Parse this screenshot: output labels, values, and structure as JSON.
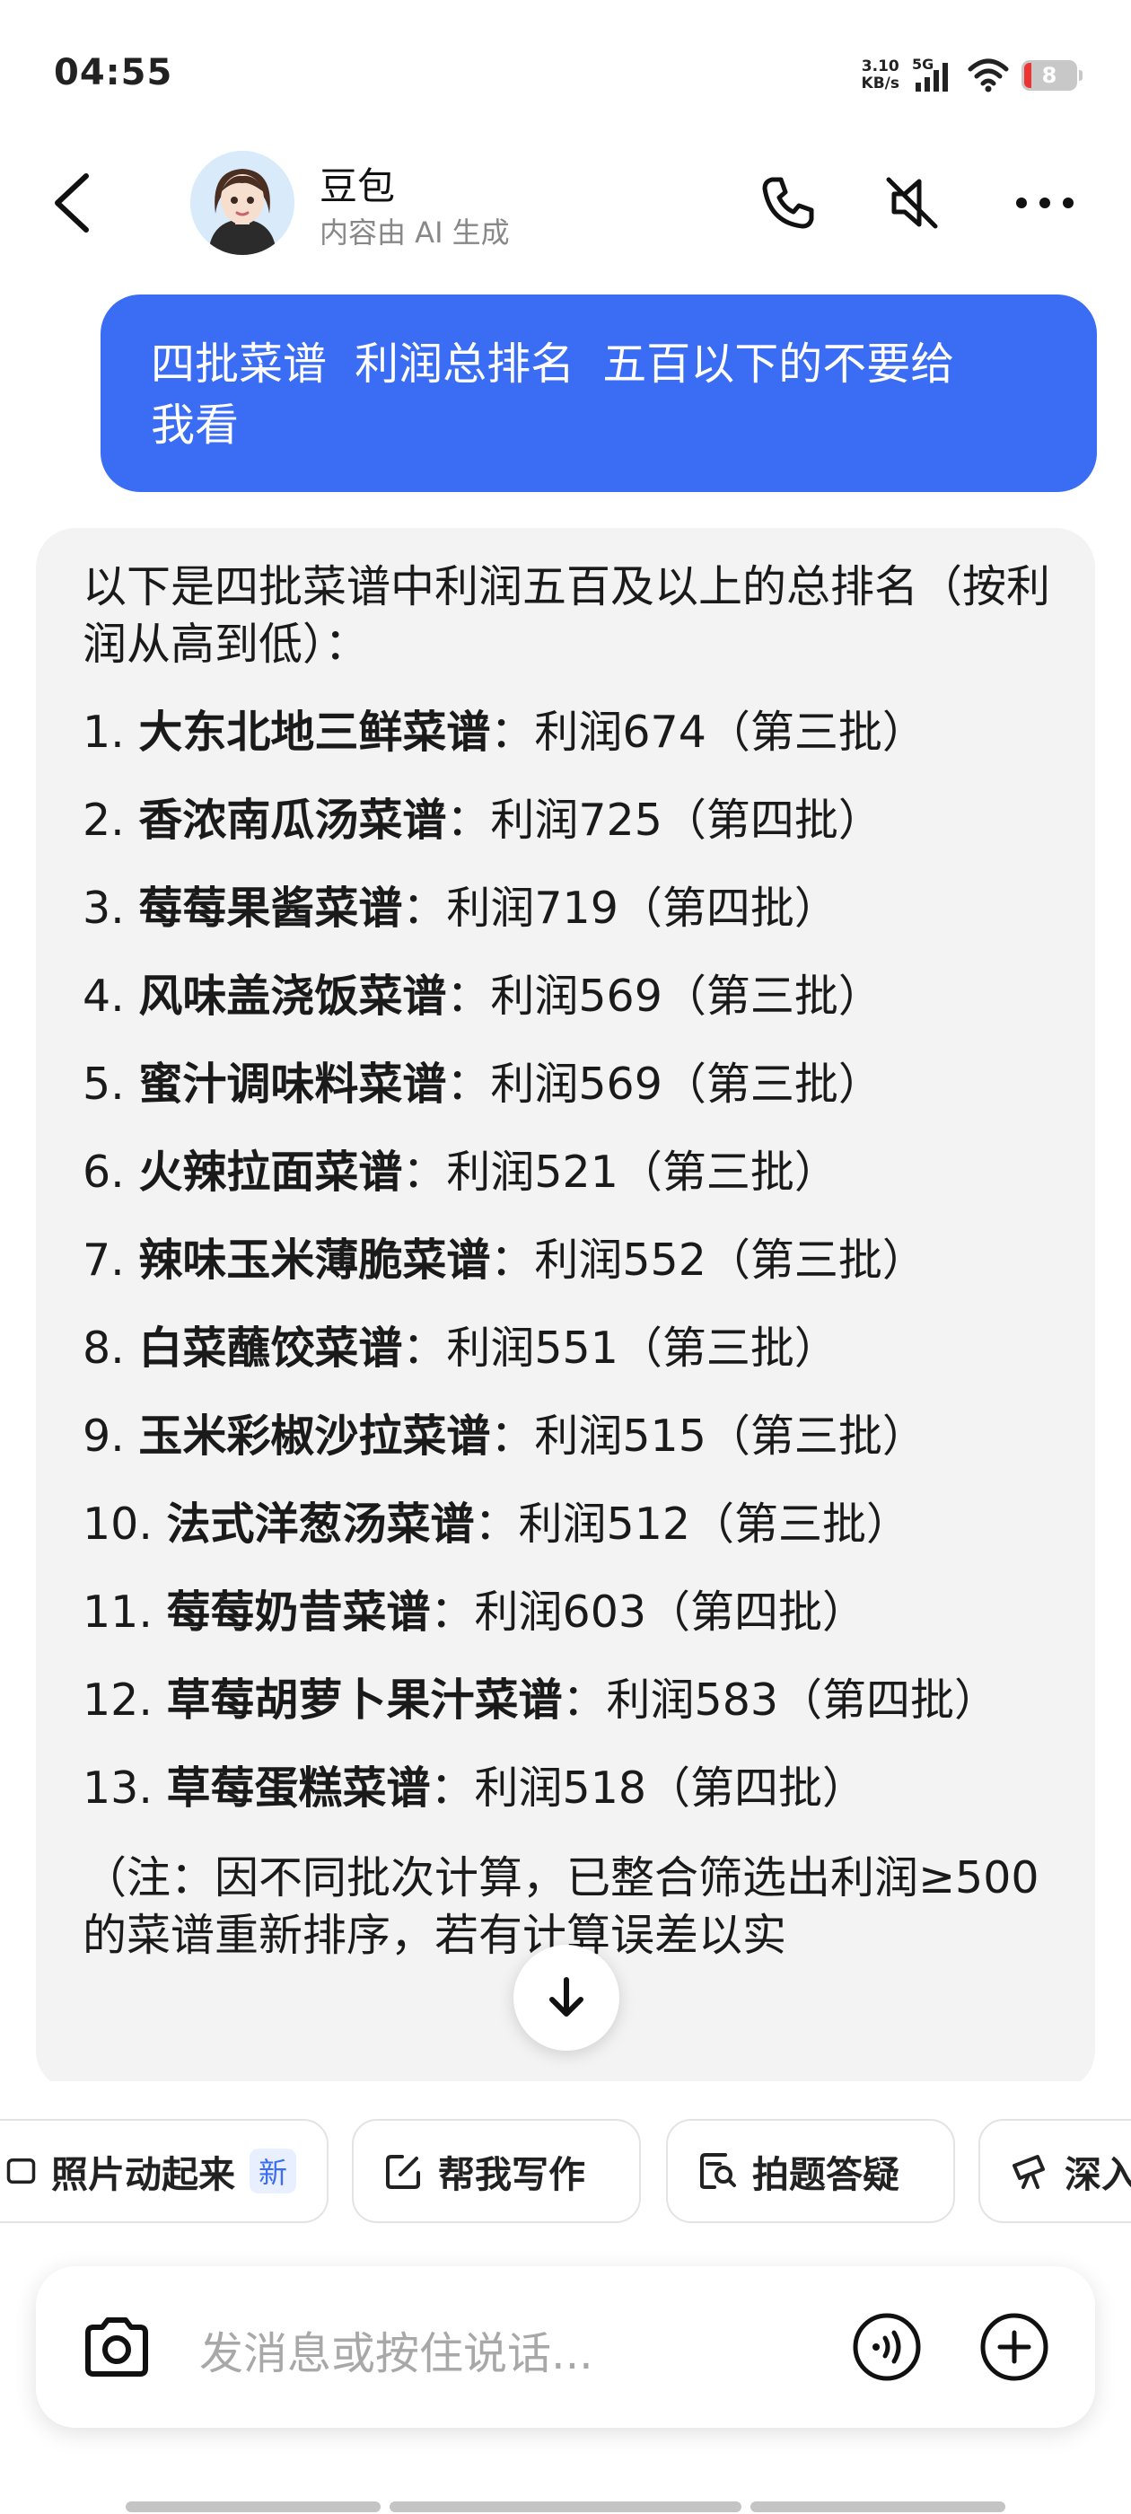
{
  "status": {
    "time": "04:55",
    "net_speed_value": "3.10",
    "net_speed_unit": "KB/s",
    "network": "5G",
    "battery": "8"
  },
  "header": {
    "name": "豆包",
    "subtitle": "内容由 AI 生成"
  },
  "user_message": "四批菜谱  利润总排名  五百以下的不要给\n我看",
  "bot": {
    "intro": "以下是四批菜谱中利润五百及以上的总排名（按利润从高到低）：",
    "items": [
      {
        "num": "1.",
        "name": "大东北地三鲜菜谱",
        "detail": "：利润674（第三批）"
      },
      {
        "num": "2.",
        "name": "香浓南瓜汤菜谱",
        "detail": "：利润725（第四批）"
      },
      {
        "num": "3.",
        "name": "莓莓果酱菜谱",
        "detail": "：利润719（第四批）"
      },
      {
        "num": "4.",
        "name": "风味盖浇饭菜谱",
        "detail": "：利润569（第三批）"
      },
      {
        "num": "5.",
        "name": "蜜汁调味料菜谱",
        "detail": "：利润569（第三批）"
      },
      {
        "num": "6.",
        "name": "火辣拉面菜谱",
        "detail": "：利润521（第三批）"
      },
      {
        "num": "7.",
        "name": "辣味玉米薄脆菜谱",
        "detail": "：利润552（第三批）"
      },
      {
        "num": "8.",
        "name": "白菜蘸饺菜谱",
        "detail": "：利润551（第三批）"
      },
      {
        "num": "9.",
        "name": "玉米彩椒沙拉菜谱",
        "detail": "：利润515（第三批）"
      },
      {
        "num": "10.",
        "name": "法式洋葱汤菜谱",
        "detail": "：利润512（第三批）"
      },
      {
        "num": "11.",
        "name": "莓莓奶昔菜谱",
        "detail": "：利润603（第四批）"
      },
      {
        "num": "12.",
        "name": "草莓胡萝卜果汁菜谱",
        "detail": "：利润583（第四批）"
      },
      {
        "num": "13.",
        "name": "草莓蛋糕菜谱",
        "detail": "：利润518（第四批）"
      }
    ],
    "note": "（注：因不同批次计算，已整合筛选出利润≥500的菜谱重新排序，若有计算误差以实"
  },
  "chips": {
    "photo_animate": "照片动起来",
    "new_badge": "新",
    "write": "帮我写作",
    "photo_qa": "拍题答疑",
    "deep": "深入"
  },
  "input": {
    "placeholder": "发消息或按住说话..."
  },
  "colors": {
    "accent": "#3a6cf4",
    "bubble_bg": "#f3f3f3"
  }
}
